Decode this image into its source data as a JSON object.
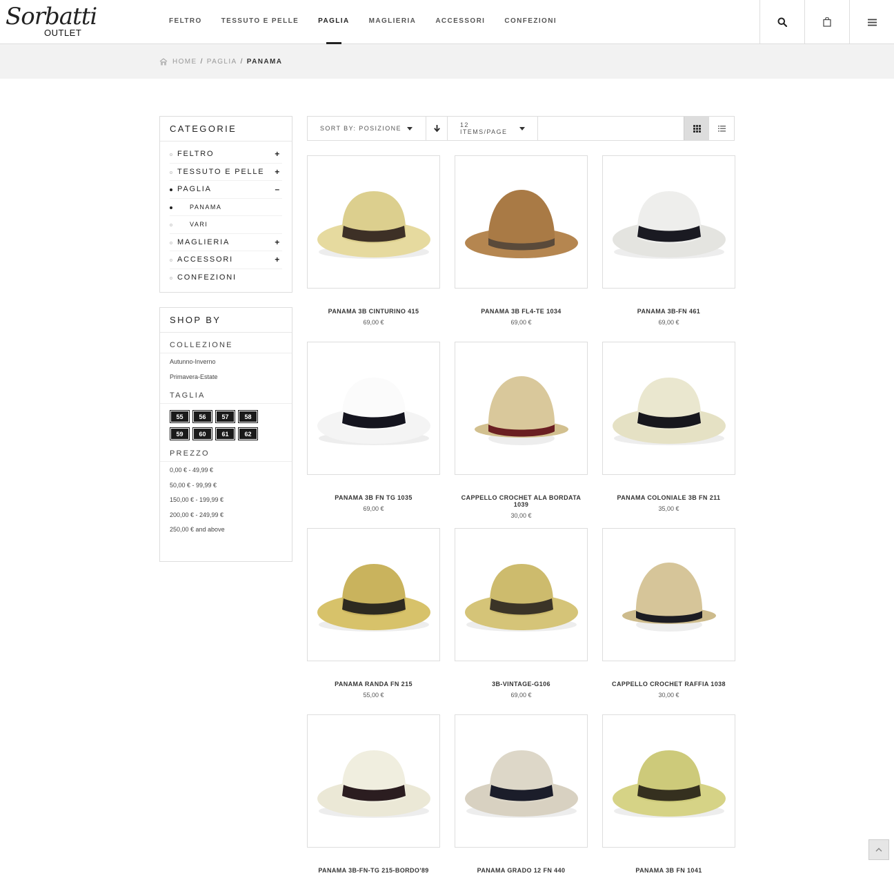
{
  "brand": {
    "script": "Sorbatti",
    "sub": "OUTLET"
  },
  "nav": [
    "FELTRO",
    "TESSUTO E PELLE",
    "PAGLIA",
    "MAGLIERIA",
    "ACCESSORI",
    "CONFEZIONI"
  ],
  "nav_active": "PAGLIA",
  "header_icons": [
    "search-icon",
    "shopping-bag-icon",
    "menu-icon"
  ],
  "breadcrumb": {
    "home": "HOME",
    "parent": "PAGLIA",
    "current": "PANAMA",
    "separator": "/"
  },
  "categories": {
    "title": "CATEGORIE",
    "items": [
      {
        "label": "FELTRO",
        "toggle": "+"
      },
      {
        "label": "TESSUTO E PELLE",
        "toggle": "+"
      },
      {
        "label": "PAGLIA",
        "toggle": "–"
      },
      {
        "label": "PANAMA",
        "toggle": ""
      },
      {
        "label": "VARI",
        "toggle": ""
      },
      {
        "label": "MAGLIERIA",
        "toggle": "+"
      },
      {
        "label": "ACCESSORI",
        "toggle": "+"
      },
      {
        "label": "CONFEZIONI",
        "toggle": ""
      }
    ]
  },
  "shopby": {
    "title": "SHOP BY",
    "collezione_title": "COLLEZIONE",
    "collezione": [
      "Autunno-Inverno",
      "Primavera-Estate"
    ],
    "taglia_title": "TAGLIA",
    "taglia": [
      "55",
      "56",
      "57",
      "58",
      "59",
      "60",
      "61",
      "62"
    ],
    "prezzo_title": "PREZZO",
    "prezzo": [
      "0,00 € - 49,99 €",
      "50,00 € - 99,99 €",
      "150,00 € - 199,99 €",
      "200,00 € - 249,99 €",
      "250,00 € and above"
    ]
  },
  "toolbar": {
    "sort_prefix": "SORT BY:",
    "sort_value": "POSIZIONE",
    "per_page": "12 ITEMS/PAGE",
    "view_modes": [
      "grid-icon",
      "list-icon"
    ]
  },
  "products": [
    {
      "name": "PANAMA 3B CINTURINO 415",
      "price": "69,00 €",
      "crown": "#dccf8e",
      "brim": "#e6da9f",
      "band": "#3d3026"
    },
    {
      "name": "PANAMA 3B FL4-TE 1034",
      "price": "69,00 €",
      "crown": "#a97a45",
      "brim": "#b58650",
      "band": "#5a4a3a"
    },
    {
      "name": "PANAMA 3B-FN 461",
      "price": "69,00 €",
      "crown": "#eeeeec",
      "brim": "#e4e4e0",
      "band": "#1a1a22"
    },
    {
      "name": "PANAMA 3B FN TG 1035",
      "price": "69,00 €",
      "crown": "#fbfbfb",
      "brim": "#f4f4f4",
      "band": "#15151f"
    },
    {
      "name": "CAPPELLO CROCHET ALA BORDATA 1039",
      "price": "30,00 €",
      "crown": "#d9c89b",
      "brim": "#d2c08f",
      "band": "#6a1f22"
    },
    {
      "name": "PANAMA COLONIALE 3B FN 211",
      "price": "35,00 €",
      "crown": "#eae7cf",
      "brim": "#e5e1c4",
      "band": "#17171d"
    },
    {
      "name": "PANAMA RANDA FN 215",
      "price": "55,00 €",
      "crown": "#c9b35d",
      "brim": "#d7c26a",
      "band": "#2d2a20"
    },
    {
      "name": "3B-VINTAGE-G106",
      "price": "69,00 €",
      "crown": "#cdbb6d",
      "brim": "#d5c478",
      "band": "#3b3427"
    },
    {
      "name": "CAPPELLO CROCHET RAFFIA 1038",
      "price": "30,00 €",
      "crown": "#d6c599",
      "brim": "#cdbb8c",
      "band": "#1c1c22"
    },
    {
      "name": "PANAMA 3B-FN-TG 215-BORDO'89",
      "price": "",
      "crown": "#f0eedf",
      "brim": "#ebe8d6",
      "band": "#2b1d20"
    },
    {
      "name": "PANAMA GRADO 12 FN 440",
      "price": "",
      "crown": "#ddd7c8",
      "brim": "#d8d1c1",
      "band": "#1b1d2a"
    },
    {
      "name": "PANAMA 3B FN 1041",
      "price": "",
      "crown": "#cdca7a",
      "brim": "#d6d386",
      "band": "#35301f"
    }
  ]
}
